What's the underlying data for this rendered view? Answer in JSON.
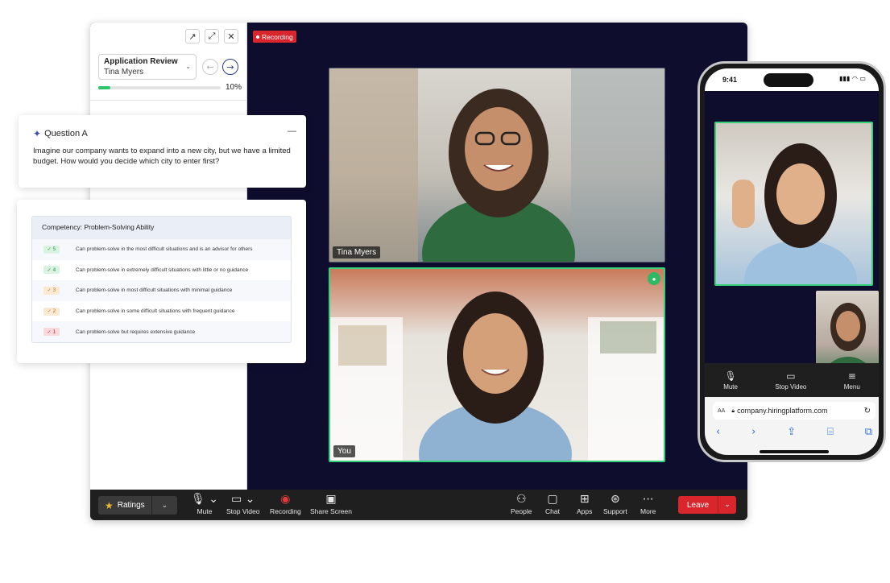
{
  "side_panel": {
    "review_title": "Application Review",
    "candidate": "Tina Myers",
    "progress_percent": 10,
    "progress_label": "10%",
    "icons": [
      "external-link-icon",
      "expand-icon",
      "close-icon"
    ]
  },
  "recording_badge": "Recording",
  "tiles": {
    "top_name": "Tina Myers",
    "bottom_name": "You"
  },
  "question_card": {
    "title": "Question A",
    "text": "Imagine our company wants to expand into a new city, but we have a limited budget. How would you decide which city to enter first?"
  },
  "competency_card": {
    "header": "Competency: Problem-Solving Ability",
    "rows": [
      {
        "score": "✓ 5",
        "text": "Can problem-solve in the most difficult situations and is an advisor for others",
        "badge_bg": "#d9f3e1",
        "badge_fg": "#2a8a4c"
      },
      {
        "score": "✓ 4",
        "text": "Can problem-solve in extremely difficult situations with little or no guidance",
        "badge_bg": "#d9f3e1",
        "badge_fg": "#2a8a4c"
      },
      {
        "score": "✓ 3",
        "text": "Can problem-solve in most difficult situations with minimal guidance",
        "badge_bg": "#fbead3",
        "badge_fg": "#b06b16"
      },
      {
        "score": "✓ 2",
        "text": "Can problem-solve in some difficult situations with frequent guidance",
        "badge_bg": "#fbead3",
        "badge_fg": "#b06b16"
      },
      {
        "score": "✓ 1",
        "text": "Can problem-solve but requires extensive guidance",
        "badge_bg": "#f9d9db",
        "badge_fg": "#b3262d"
      }
    ]
  },
  "toolbar": {
    "ratings_label": "Ratings",
    "mute_label": "Mute",
    "stop_video_label": "Stop Video",
    "recording_label": "Recording",
    "share_screen_label": "Share Screen",
    "people_label": "People",
    "chat_label": "Chat",
    "apps_label": "Apps",
    "support_label": "Support",
    "more_label": "More",
    "leave_label": "Leave"
  },
  "phone": {
    "time": "9:41",
    "mute_label": "Mute",
    "stop_video_label": "Stop Video",
    "menu_label": "Menu",
    "url_prefix": "AA",
    "url": "company.hiringplatform.com"
  },
  "colors": {
    "accent_green": "#33d17a",
    "recording_red": "#d9262c",
    "call_bg": "#0e0d2e"
  }
}
